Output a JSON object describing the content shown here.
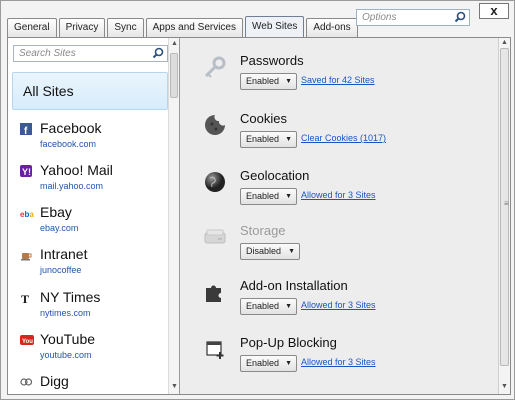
{
  "window": {
    "close_label": "x",
    "search_placeholder": "Options"
  },
  "tabs": [
    {
      "label": "General"
    },
    {
      "label": "Privacy"
    },
    {
      "label": "Sync"
    },
    {
      "label": "Apps and Services"
    },
    {
      "label": "Web Sites",
      "active": true
    },
    {
      "label": "Add-ons"
    }
  ],
  "sidebar": {
    "search_placeholder": "Search Sites",
    "all_sites_label": "All Sites",
    "sites": [
      {
        "name": "Facebook",
        "url": "facebook.com",
        "icon": "facebook-icon"
      },
      {
        "name": "Yahoo! Mail",
        "url": "mail.yahoo.com",
        "icon": "yahoo-icon"
      },
      {
        "name": "Ebay",
        "url": "ebay.com",
        "icon": "ebay-icon"
      },
      {
        "name": "Intranet",
        "url": "junocoffee",
        "icon": "coffee-cup-icon"
      },
      {
        "name": "NY Times",
        "url": "nytimes.com",
        "icon": "nytimes-icon"
      },
      {
        "name": "YouTube",
        "url": "youtube.com",
        "icon": "youtube-icon"
      },
      {
        "name": "Digg",
        "url": "",
        "icon": "digg-icon"
      }
    ]
  },
  "permissions": [
    {
      "title": "Passwords",
      "value": "Enabled",
      "link": "Saved for 42 Sites",
      "icon": "key-icon",
      "enabled": true
    },
    {
      "title": "Cookies",
      "value": "Enabled",
      "link": "Clear Cookies (1017)",
      "icon": "cookie-icon",
      "enabled": true
    },
    {
      "title": "Geolocation",
      "value": "Enabled",
      "link": "Allowed for 3 Sites",
      "icon": "globe-icon",
      "enabled": true
    },
    {
      "title": "Storage",
      "value": "Disabled",
      "link": "",
      "icon": "storage-drive-icon",
      "enabled": false
    },
    {
      "title": "Add-on Installation",
      "value": "Enabled",
      "link": "Allowed for 3 Sites",
      "icon": "puzzle-piece-icon",
      "enabled": true
    },
    {
      "title": "Pop-Up Blocking",
      "value": "Enabled",
      "link": "Allowed for 3 Sites",
      "icon": "popup-window-icon",
      "enabled": true
    }
  ],
  "colors": {
    "link": "#1a55c4",
    "selected_bg": "#d7ecfb",
    "disabled_text": "#9a9a9a"
  }
}
